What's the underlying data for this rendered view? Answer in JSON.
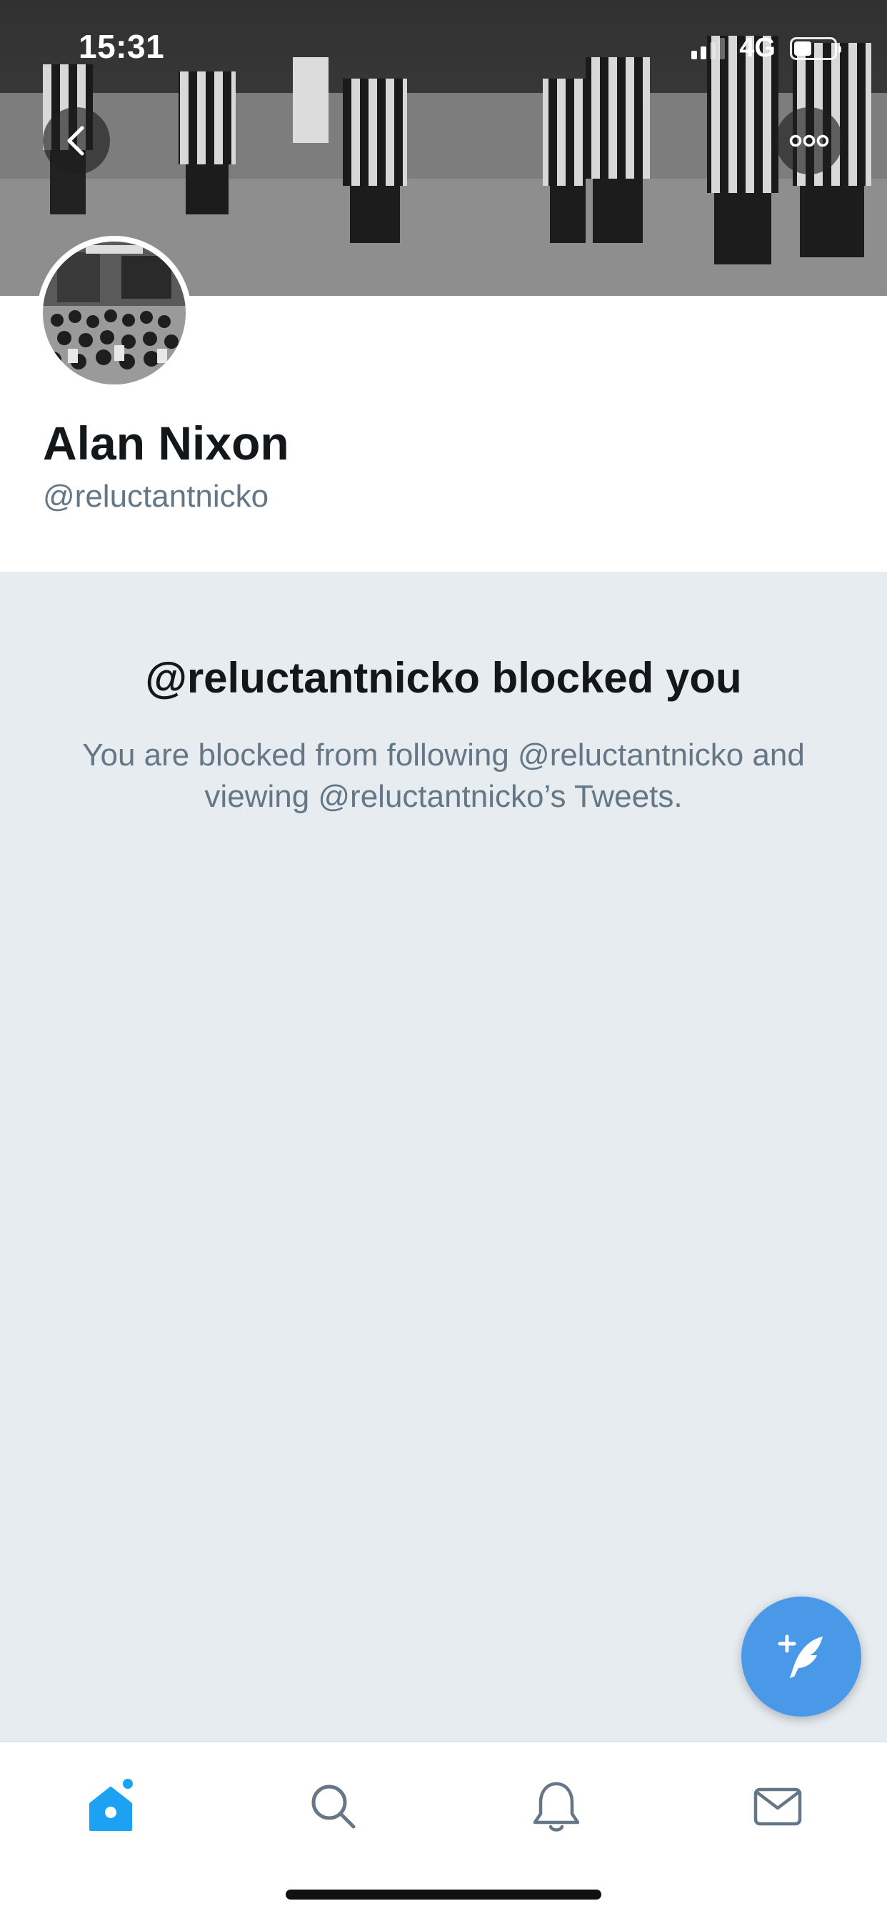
{
  "status_bar": {
    "time": "15:31",
    "network": "4G",
    "signal_icon": "cellular-signal-icon",
    "battery_icon": "battery-icon"
  },
  "header": {
    "back_icon": "chevron-left-icon",
    "more_icon": "more-horizontal-icon"
  },
  "profile": {
    "display_name": "Alan Nixon",
    "handle": "@reluctantnicko"
  },
  "blocked_notice": {
    "title": "@reluctantnicko blocked you",
    "body": "You are blocked from following @reluctantnicko and viewing @reluctantnicko’s Tweets."
  },
  "compose": {
    "icon": "compose-tweet-icon"
  },
  "tab_bar": {
    "tabs": [
      {
        "name": "home",
        "icon": "home-icon",
        "active": true,
        "has_badge": true
      },
      {
        "name": "search",
        "icon": "search-icon",
        "active": false
      },
      {
        "name": "notifications",
        "icon": "bell-icon",
        "active": false
      },
      {
        "name": "messages",
        "icon": "mail-icon",
        "active": false
      }
    ]
  },
  "colors": {
    "accent": "#1da1f2",
    "fab": "#4a99e9",
    "background": "#e6ecf0",
    "primary_text": "#14171a",
    "secondary_text": "#657786",
    "icon_inactive": "#657786"
  }
}
